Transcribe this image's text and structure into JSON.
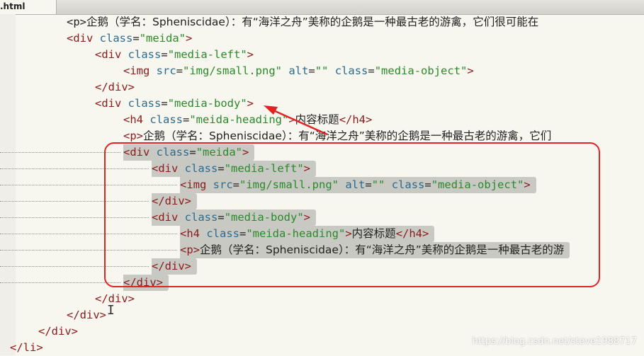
{
  "tab": {
    "label": ".html"
  },
  "code_lines": [
    {
      "indent": 2,
      "segments": [
        [
          "p",
          "<p>"
        ],
        [
          "cjk",
          "企鹅（学名：Spheniscidae）：有“海洋之舟”美称的企鹅是一种最古老的游禽，它们很可能在"
        ]
      ],
      "selected": false
    },
    {
      "indent": 2,
      "segments": [
        [
          "t",
          "<div "
        ],
        [
          "a",
          "class"
        ],
        [
          "p",
          "="
        ],
        [
          "v",
          "\"meida\""
        ],
        [
          "t",
          ">"
        ]
      ],
      "selected": false
    },
    {
      "indent": 3,
      "segments": [
        [
          "t",
          "<div "
        ],
        [
          "a",
          "class"
        ],
        [
          "p",
          "="
        ],
        [
          "v",
          "\"media-left\""
        ],
        [
          "t",
          ">"
        ]
      ],
      "selected": false
    },
    {
      "indent": 4,
      "segments": [
        [
          "t",
          "<img "
        ],
        [
          "a",
          "src"
        ],
        [
          "p",
          "="
        ],
        [
          "v",
          "\"img/small.png\""
        ],
        [
          "p",
          " "
        ],
        [
          "a",
          "alt"
        ],
        [
          "p",
          "="
        ],
        [
          "v",
          "\"\""
        ],
        [
          "p",
          " "
        ],
        [
          "a",
          "class"
        ],
        [
          "p",
          "="
        ],
        [
          "v",
          "\"media-object\""
        ],
        [
          "t",
          ">"
        ]
      ],
      "selected": false
    },
    {
      "indent": 3,
      "segments": [
        [
          "t",
          "</div>"
        ]
      ],
      "selected": false
    },
    {
      "indent": 3,
      "segments": [
        [
          "t",
          "<div "
        ],
        [
          "a",
          "class"
        ],
        [
          "p",
          "="
        ],
        [
          "v",
          "\"media-body\""
        ],
        [
          "t",
          ">"
        ]
      ],
      "selected": false
    },
    {
      "indent": 4,
      "segments": [
        [
          "t",
          "<h4 "
        ],
        [
          "a",
          "class"
        ],
        [
          "p",
          "="
        ],
        [
          "v",
          "\"meida-heading\""
        ],
        [
          "t",
          ">"
        ],
        [
          "cjk",
          "内容标题"
        ],
        [
          "t",
          "</h4>"
        ]
      ],
      "selected": false
    },
    {
      "indent": 4,
      "segments": [
        [
          "t",
          "<p>"
        ],
        [
          "cjk",
          "企鹅（学名：Spheniscidae）：有“海洋之舟”美称的企鹅是一种最古老的游禽，它们"
        ]
      ],
      "selected": false
    },
    {
      "indent": 4,
      "segments": [
        [
          "t",
          "<div "
        ],
        [
          "a",
          "class"
        ],
        [
          "p",
          "="
        ],
        [
          "v",
          "\"meida\""
        ],
        [
          "t",
          ">"
        ]
      ],
      "selected": true
    },
    {
      "indent": 5,
      "segments": [
        [
          "t",
          "<div "
        ],
        [
          "a",
          "class"
        ],
        [
          "p",
          "="
        ],
        [
          "v",
          "\"media-left\""
        ],
        [
          "t",
          ">"
        ]
      ],
      "selected": true
    },
    {
      "indent": 6,
      "segments": [
        [
          "t",
          "<img "
        ],
        [
          "a",
          "src"
        ],
        [
          "p",
          "="
        ],
        [
          "v",
          "\"img/small.png\""
        ],
        [
          "p",
          " "
        ],
        [
          "a",
          "alt"
        ],
        [
          "p",
          "="
        ],
        [
          "v",
          "\"\""
        ],
        [
          "p",
          " "
        ],
        [
          "a",
          "class"
        ],
        [
          "p",
          "="
        ],
        [
          "v",
          "\"media-object\""
        ],
        [
          "t",
          ">"
        ]
      ],
      "selected": true
    },
    {
      "indent": 5,
      "segments": [
        [
          "t",
          "</div>"
        ]
      ],
      "selected": true
    },
    {
      "indent": 5,
      "segments": [
        [
          "t",
          "<div "
        ],
        [
          "a",
          "class"
        ],
        [
          "p",
          "="
        ],
        [
          "v",
          "\"media-body\""
        ],
        [
          "t",
          ">"
        ]
      ],
      "selected": true
    },
    {
      "indent": 6,
      "segments": [
        [
          "t",
          "<h4 "
        ],
        [
          "a",
          "class"
        ],
        [
          "p",
          "="
        ],
        [
          "v",
          "\"meida-heading\""
        ],
        [
          "t",
          ">"
        ],
        [
          "cjk",
          "内容标题"
        ],
        [
          "t",
          "</h4>"
        ]
      ],
      "selected": true
    },
    {
      "indent": 6,
      "segments": [
        [
          "t",
          "<p>"
        ],
        [
          "cjk",
          "企鹅（学名：Spheniscidae）：有“海洋之舟”美称的企鹅是一种最古老的游"
        ]
      ],
      "selected": true
    },
    {
      "indent": 5,
      "segments": [
        [
          "t",
          "</div>"
        ]
      ],
      "selected": true
    },
    {
      "indent": 4,
      "segments": [
        [
          "t",
          "</div>"
        ]
      ],
      "selected": true
    },
    {
      "indent": 3,
      "segments": [
        [
          "t",
          "</div>"
        ]
      ],
      "selected": false
    },
    {
      "indent": 2,
      "segments": [
        [
          "t",
          "</div>"
        ]
      ],
      "selected": false
    },
    {
      "indent": 1,
      "segments": [
        [
          "t",
          "</div>"
        ]
      ],
      "selected": false
    },
    {
      "indent": 0,
      "segments": [
        [
          "t",
          "</li>"
        ]
      ],
      "selected": false
    }
  ],
  "annotation": {
    "color": "#e02424",
    "arrow_target": "media-body"
  },
  "cursor_glyph": "I",
  "watermark": "https://blog.csdn.net/steve1988717"
}
